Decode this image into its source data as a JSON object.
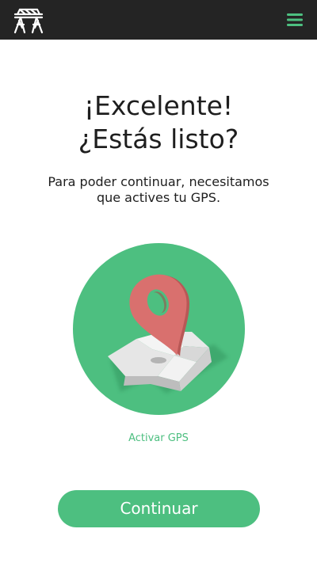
{
  "header": {
    "logo_icon": "bridge-icon",
    "menu_icon": "hamburger-menu-icon",
    "background_color": "#242424",
    "accent_color": "#4dbf80"
  },
  "main": {
    "headline_line1": "¡Excelente!",
    "headline_line2": "¿Estás listo?",
    "subtitle_line1": "Para poder continuar, necesitamos",
    "subtitle_line2": "que actives tu GPS.",
    "illustration_icon": "map-location-pin-icon",
    "gps_link_label": "Activar GPS",
    "continue_label": "Continuar"
  },
  "colors": {
    "brand_green": "#4dbf80",
    "pin_red": "#d9706e",
    "text_dark": "#1e1e1e"
  }
}
